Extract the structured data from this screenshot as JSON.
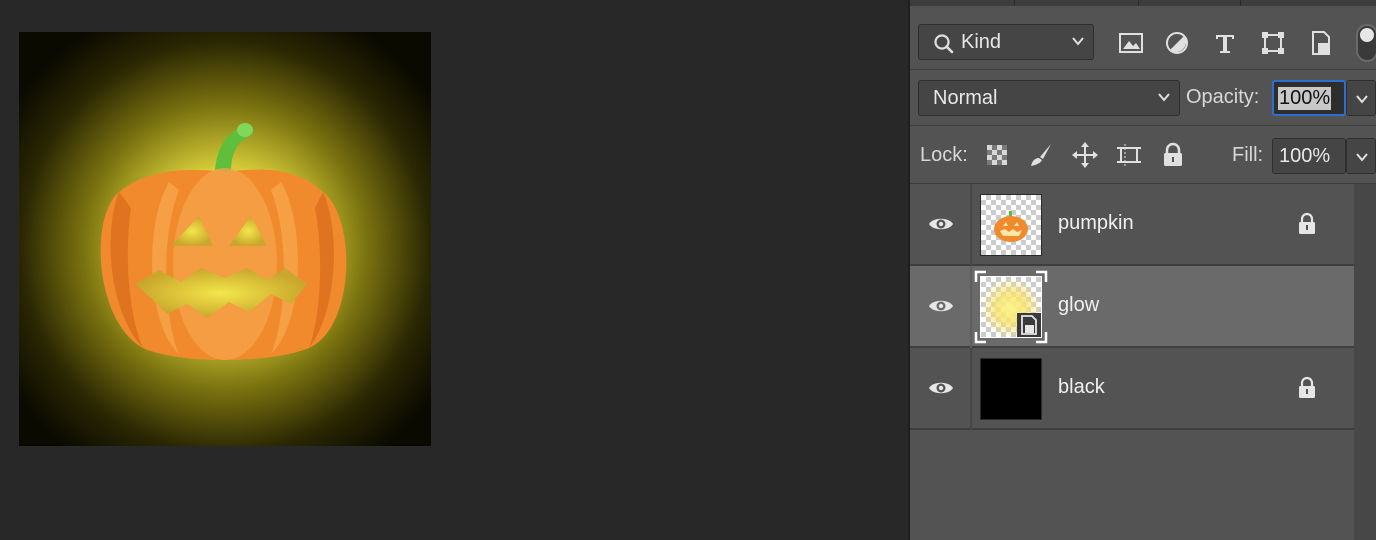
{
  "canvas": {
    "artwork": "jack-o-lantern with glow on black background"
  },
  "layers_panel": {
    "filter": {
      "kind_label": "Kind",
      "tools": [
        "image-filter-icon",
        "adjustment-filter-icon",
        "type-filter-icon",
        "shape-filter-icon",
        "smart-object-filter-icon"
      ]
    },
    "blend": {
      "mode": "Normal",
      "opacity_label": "Opacity:",
      "opacity_value": "100%"
    },
    "lock": {
      "label": "Lock:",
      "icons": [
        "lock-transparent-pixels-icon",
        "lock-image-pixels-icon",
        "lock-position-icon",
        "lock-artboard-icon",
        "lock-all-icon"
      ],
      "fill_label": "Fill:",
      "fill_value": "100%"
    },
    "layers": [
      {
        "name": "pumpkin",
        "locked": true,
        "selected": false
      },
      {
        "name": "glow",
        "locked": false,
        "selected": true
      },
      {
        "name": "black",
        "locked": true,
        "selected": false
      }
    ]
  },
  "colors": {
    "panel_bg": "#535353",
    "selected_layer": "#6a6a6a",
    "accent_focus": "#2d6fd0",
    "pumpkin_orange": "#f08a2c",
    "glow_yellow": "#e8e04a"
  }
}
